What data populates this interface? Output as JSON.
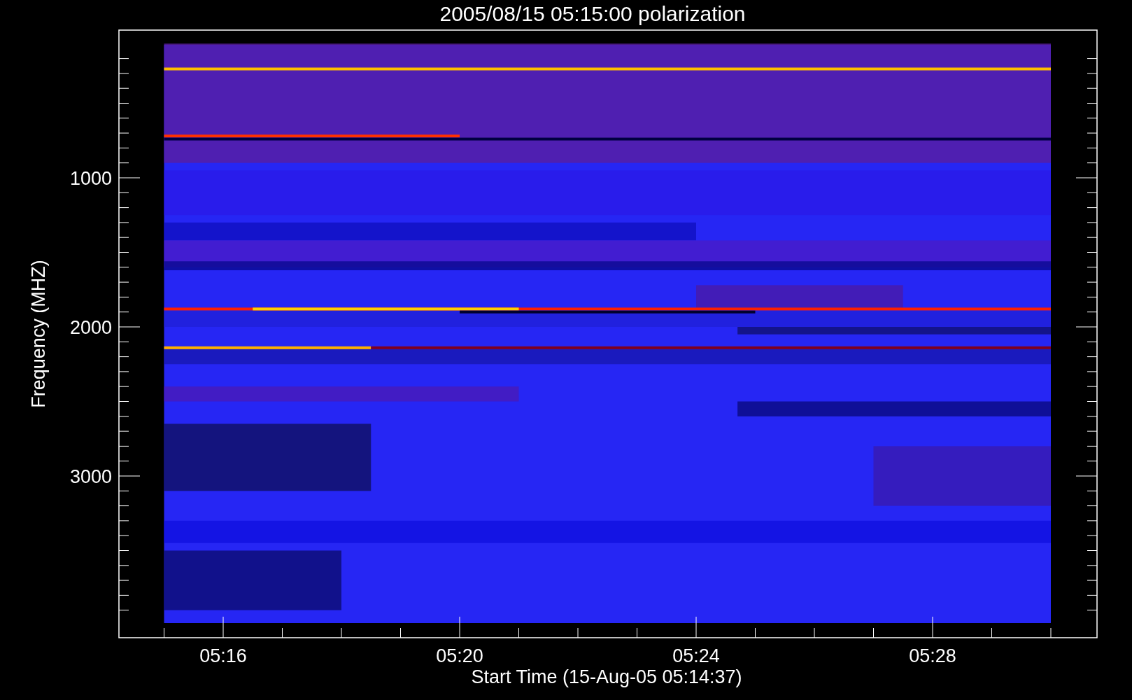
{
  "title": "2005/08/15 05:15:00 polarization",
  "y_axis": {
    "label": "Frequency (MHZ)",
    "ticks": [
      "1000",
      "2000",
      "3000"
    ]
  },
  "x_axis": {
    "label": "Start Time (15-Aug-05 05:14:37)",
    "ticks": [
      "05:16",
      "05:20",
      "05:24",
      "05:28"
    ]
  }
}
